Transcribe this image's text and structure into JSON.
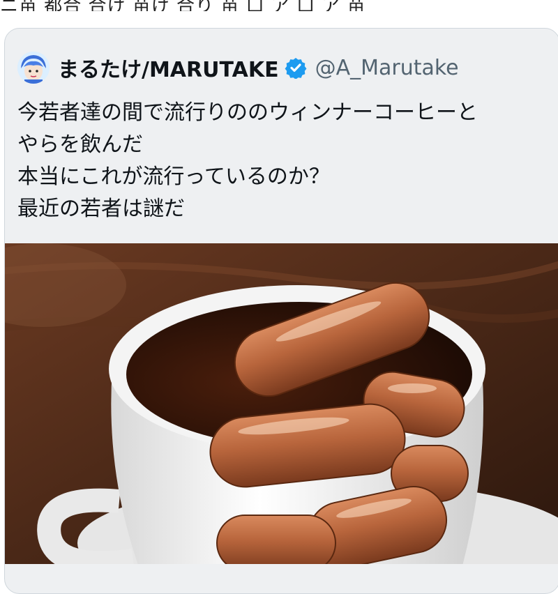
{
  "previous_tweet": {
    "cut_text": "ニ苗 都合 合け 苗け 合り 苗 口 ア 口 ア 苗"
  },
  "quoted_tweet": {
    "author": {
      "display_name": "まるたけ/MARUTAKE",
      "handle": "@A_Marutake",
      "verified": true
    },
    "text_lines": [
      "今若者達の間で流行りののウィンナーコーヒーと",
      "やらを飲んだ",
      "本当にこれが流行っているのか？",
      "最近の若者は謎だ"
    ],
    "media": {
      "icon": "photo",
      "depicts": "coffee-cup-with-sausages"
    }
  },
  "colors": {
    "card_background": "#eef0f2",
    "card_border": "#cfd6dc",
    "verified_badge": "#1d9bf0",
    "handle": "#536471",
    "text": "#0f1419"
  }
}
